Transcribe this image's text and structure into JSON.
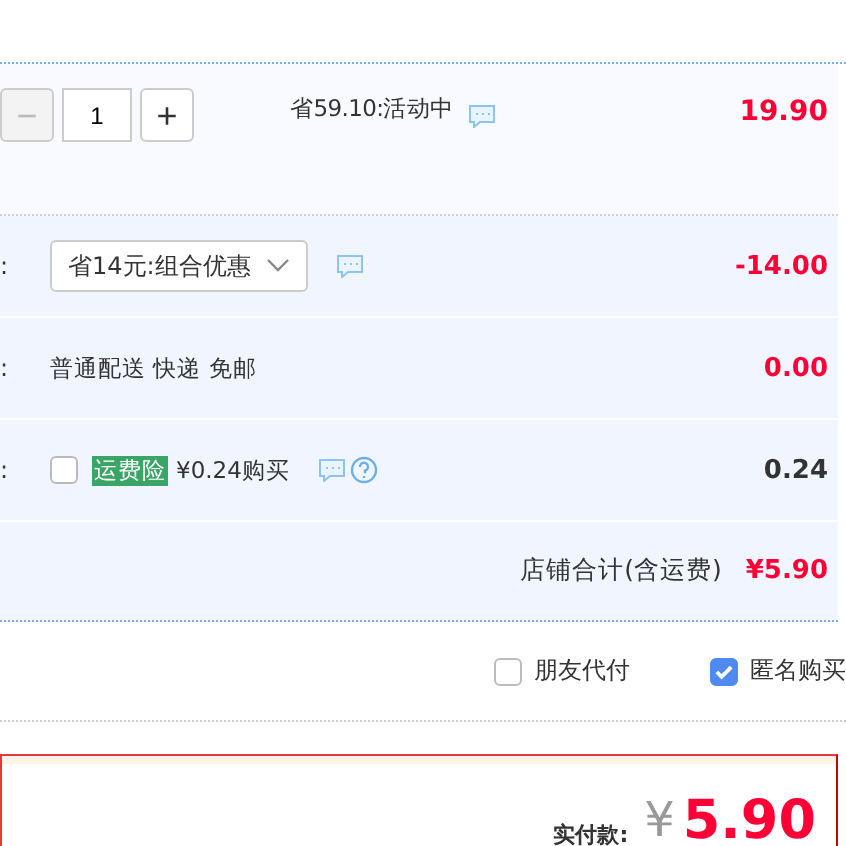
{
  "item": {
    "quantity": "1",
    "minus": "−",
    "plus": "+",
    "promo": "省59.10:活动中",
    "price": "19.90",
    "minus_disabled": true
  },
  "rows": [
    {
      "kind": "select",
      "label": ":",
      "value": "省14元:组合优惠",
      "amount": "-14.00",
      "red": true
    },
    {
      "kind": "text",
      "label": ":",
      "value": "普通配送 快递 免邮",
      "amount": "0.00",
      "red": true
    },
    {
      "kind": "insurance",
      "label": ":",
      "tag": "运费险",
      "value": "¥0.24购买",
      "checked": false,
      "amount": "0.24",
      "red": false
    }
  ],
  "total": {
    "label": "店铺合计(含运费)",
    "amount": "¥5.90"
  },
  "options": [
    {
      "label": "朋友代付",
      "checked": false
    },
    {
      "label": "匿名购买",
      "checked": true
    }
  ],
  "pay": {
    "label": "实付款:",
    "currency": "¥",
    "amount": "5.90"
  }
}
